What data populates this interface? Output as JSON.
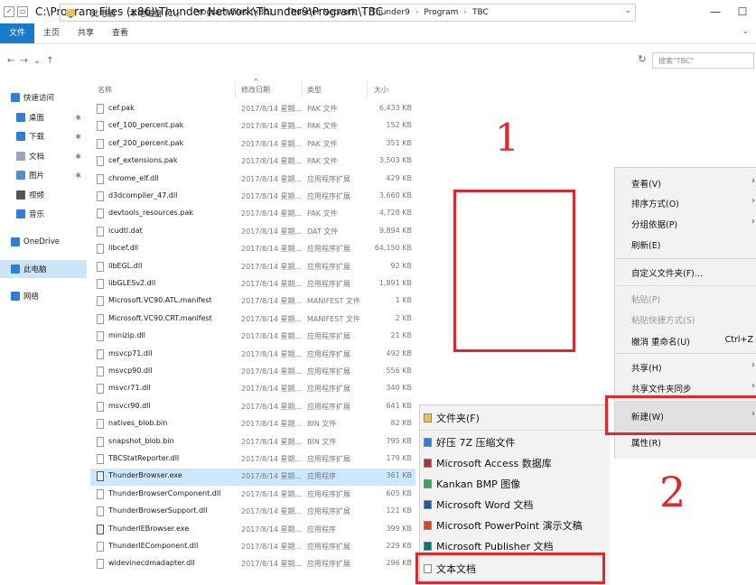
{
  "window": {
    "title": "C:\\Program Files (x86)\\Thunder Network\\Thunder9\\Program\\TBC",
    "minimize": "—",
    "maximize": "☐"
  },
  "ribbon": {
    "tabs": [
      "文件",
      "主页",
      "共享",
      "查看"
    ],
    "expand": "⌄"
  },
  "address": {
    "back": "←",
    "forward": "→",
    "up_list": "⌄",
    "up": "↑",
    "crumbs": [
      "此电脑",
      "本地磁盘 (C:)",
      "Program Files (x86)",
      "Thunder Network",
      "Thunder9",
      "Program",
      "TBC"
    ],
    "dropdown": "⌄",
    "refresh": "↻",
    "search_placeholder": "搜索\"TBC\""
  },
  "navpane": {
    "items": [
      {
        "label": "快速访问",
        "icon": "star-icon"
      },
      {
        "label": "桌面",
        "icon": "desktop-icon",
        "pinned": true
      },
      {
        "label": "下载",
        "icon": "download-icon",
        "pinned": true
      },
      {
        "label": "文档",
        "icon": "document-icon",
        "pinned": true
      },
      {
        "label": "图片",
        "icon": "picture-icon",
        "pinned": true
      },
      {
        "label": "视频",
        "icon": "video-icon"
      },
      {
        "label": "音乐",
        "icon": "music-icon"
      },
      {
        "label": "OneDrive",
        "icon": "cloud-icon"
      },
      {
        "label": "此电脑",
        "icon": "computer-icon",
        "selected": true
      },
      {
        "label": "网络",
        "icon": "network-icon"
      }
    ],
    "pin_glyph": "✱"
  },
  "filelist": {
    "columns": {
      "name": "名称",
      "date": "修改日期",
      "type": "类型",
      "size": "大小"
    },
    "sort_caret": "^",
    "rows": [
      {
        "name": "cef.pak",
        "date": "2017/8/14 星期...",
        "type": "PAK 文件",
        "size": "6,433 KB"
      },
      {
        "name": "cef_100_percent.pak",
        "date": "2017/8/14 星期...",
        "type": "PAK 文件",
        "size": "152 KB"
      },
      {
        "name": "cef_200_percent.pak",
        "date": "2017/8/14 星期...",
        "type": "PAK 文件",
        "size": "351 KB"
      },
      {
        "name": "cef_extensions.pak",
        "date": "2017/8/14 星期...",
        "type": "PAK 文件",
        "size": "3,503 KB"
      },
      {
        "name": "chrome_elf.dll",
        "date": "2017/8/14 星期...",
        "type": "应用程序扩展",
        "size": "429 KB"
      },
      {
        "name": "d3dcompiler_47.dll",
        "date": "2017/8/14 星期...",
        "type": "应用程序扩展",
        "size": "3,660 KB"
      },
      {
        "name": "devtools_resources.pak",
        "date": "2017/8/14 星期...",
        "type": "PAK 文件",
        "size": "4,728 KB"
      },
      {
        "name": "icudtl.dat",
        "date": "2017/8/14 星期...",
        "type": "DAT 文件",
        "size": "9,894 KB"
      },
      {
        "name": "libcef.dll",
        "date": "2017/8/14 星期...",
        "type": "应用程序扩展",
        "size": "64,150 KB"
      },
      {
        "name": "libEGL.dll",
        "date": "2017/8/14 星期...",
        "type": "应用程序扩展",
        "size": "92 KB"
      },
      {
        "name": "libGLESv2.dll",
        "date": "2017/8/14 星期...",
        "type": "应用程序扩展",
        "size": "1,891 KB"
      },
      {
        "name": "Microsoft.VC90.ATL.manifest",
        "date": "2017/8/14 星期...",
        "type": "MANIFEST 文件",
        "size": "1 KB"
      },
      {
        "name": "Microsoft.VC90.CRT.manifest",
        "date": "2017/8/14 星期...",
        "type": "MANIFEST 文件",
        "size": "2 KB"
      },
      {
        "name": "minizip.dll",
        "date": "2017/8/14 星期...",
        "type": "应用程序扩展",
        "size": "21 KB"
      },
      {
        "name": "msvcp71.dll",
        "date": "2017/8/14 星期...",
        "type": "应用程序扩展",
        "size": "492 KB"
      },
      {
        "name": "msvcp90.dll",
        "date": "2017/8/14 星期...",
        "type": "应用程序扩展",
        "size": "556 KB"
      },
      {
        "name": "msvcr71.dll",
        "date": "2017/8/14 星期...",
        "type": "应用程序扩展",
        "size": "340 KB"
      },
      {
        "name": "msvcr90.dll",
        "date": "2017/8/14 星期...",
        "type": "应用程序扩展",
        "size": "641 KB"
      },
      {
        "name": "natives_blob.bin",
        "date": "2017/8/14 星期...",
        "type": "BIN 文件",
        "size": "82 KB"
      },
      {
        "name": "snapshot_blob.bin",
        "date": "2017/8/14 星期...",
        "type": "BIN 文件",
        "size": "795 KB"
      },
      {
        "name": "TBCStatReporter.dll",
        "date": "2017/8/14 星期...",
        "type": "应用程序扩展",
        "size": "179 KB"
      },
      {
        "name": "ThunderBrowser.exe",
        "date": "2017/8/14 星期...",
        "type": "应用程序",
        "size": "361 KB",
        "selected": true,
        "exe": true
      },
      {
        "name": "ThunderBrowserComponent.dll",
        "date": "2017/8/14 星期...",
        "type": "应用程序扩展",
        "size": "605 KB"
      },
      {
        "name": "ThunderBrowserSupport.dll",
        "date": "2017/8/14 星期...",
        "type": "应用程序扩展",
        "size": "121 KB"
      },
      {
        "name": "ThunderIEBrowser.exe",
        "date": "2017/8/14 星期...",
        "type": "应用程序",
        "size": "399 KB",
        "exe": true
      },
      {
        "name": "ThunderIEComponent.dll",
        "date": "2017/8/14 星期...",
        "type": "应用程序扩展",
        "size": "229 KB"
      },
      {
        "name": "widevinecdmadapter.dll",
        "date": "2017/8/14 星期...",
        "type": "应用程序扩展",
        "size": "296 KB"
      }
    ]
  },
  "annotations": {
    "one": "1",
    "two": "2"
  },
  "context_menu": {
    "items": [
      {
        "label": "查看(V)",
        "submenu": true
      },
      {
        "label": "排序方式(O)",
        "submenu": true
      },
      {
        "label": "分组依据(P)",
        "submenu": true
      },
      {
        "label": "刷新(E)"
      },
      {
        "label": "自定义文件夹(F)..."
      },
      {
        "label": "粘贴(P)",
        "disabled": true
      },
      {
        "label": "粘贴快捷方式(S)",
        "disabled": true
      },
      {
        "label": "撤消 重命名(U)",
        "shortcut": "Ctrl+Z"
      },
      {
        "label": "共享(H)",
        "submenu": true
      },
      {
        "label": "共享文件夹同步",
        "submenu": true
      },
      {
        "label": "新建(W)",
        "submenu": true,
        "highlighted": true
      },
      {
        "label": "属性(R)"
      }
    ],
    "arrow": "›"
  },
  "new_submenu": {
    "items": [
      {
        "label": "文件夹(F)",
        "icon": "folder-icon",
        "color": "#e6c25a"
      },
      {
        "label": "好压 7Z 压缩文件",
        "icon": "archive-icon",
        "color": "#2e7fd6"
      },
      {
        "label": "Microsoft Access 数据库",
        "icon": "access-icon",
        "color": "#a4373a"
      },
      {
        "label": "Kankan BMP 图像",
        "icon": "image-icon",
        "color": "#3aa35b"
      },
      {
        "label": "Microsoft Word 文档",
        "icon": "word-icon",
        "color": "#2b579a"
      },
      {
        "label": "Microsoft PowerPoint 演示文稿",
        "icon": "powerpoint-icon",
        "color": "#d24726"
      },
      {
        "label": "Microsoft Publisher 文档",
        "icon": "publisher-icon",
        "color": "#077568"
      },
      {
        "label": "文本文档",
        "icon": "text-file-icon",
        "color": "#ffffff"
      }
    ]
  },
  "colors": {
    "accent": "#1979ca",
    "annotation_red": "#e0272c",
    "selection": "#cce8ff"
  }
}
